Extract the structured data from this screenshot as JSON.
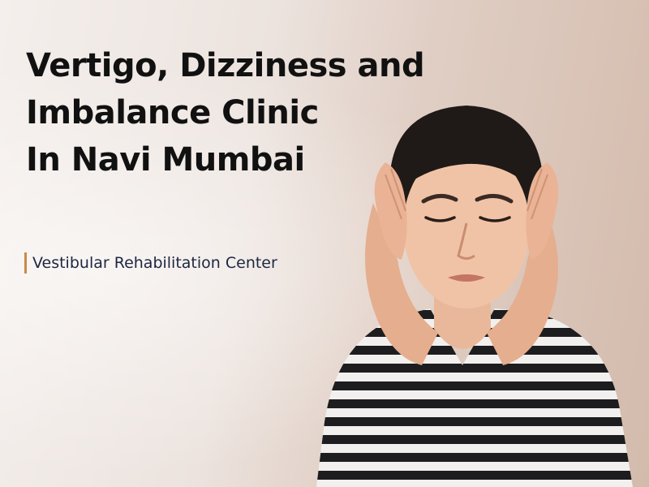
{
  "hero": {
    "title_lines": [
      "Vertigo, Dizziness and",
      "Imbalance Clinic",
      "In Navi Mumbai"
    ],
    "subtitle": "Vestibular Rehabilitation Center",
    "accent_color": "#c98a4b",
    "photo_subject": "woman-holding-head-dizzy"
  }
}
